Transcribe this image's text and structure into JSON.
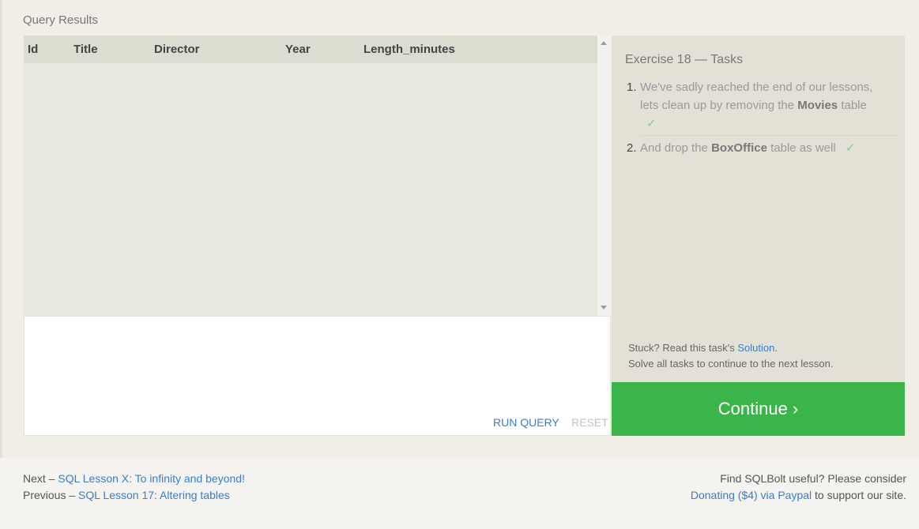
{
  "query_results": {
    "label": "Query Results",
    "columns": [
      "Id",
      "Title",
      "Director",
      "Year",
      "Length_minutes"
    ]
  },
  "editor": {
    "run_label": "RUN QUERY",
    "reset_label": "RESET"
  },
  "tasks": {
    "title": "Exercise 18 — Tasks",
    "items": [
      {
        "num": "1.",
        "pre": "We've sadly reached the end of our lessons, lets clean up by removing the",
        "bold": "Movies",
        "post": "table",
        "check": "✓"
      },
      {
        "num": "2.",
        "pre": "And drop the",
        "bold": "BoxOffice",
        "post": "table as well",
        "check": "✓"
      }
    ],
    "stuck_pre": "Stuck? Read this task's",
    "solution_label": "Solution",
    "stuck_post": ".",
    "solve_text": "Solve all tasks to continue to the next lesson."
  },
  "continue_label": "Continue ›",
  "footer": {
    "next_prefix": "Next –",
    "next_link": "SQL Lesson X: To infinity and beyond!",
    "prev_prefix": "Previous –",
    "prev_link": "SQL Lesson 17: Altering tables",
    "right_line1": "Find SQLBolt useful? Please consider",
    "donate_link": "Donating ($4) via Paypal",
    "right_suffix": "to support our site."
  },
  "colors": {
    "accent_green": "#3bb54a",
    "link_blue": "#3a7dc8",
    "check_green": "#8cc88c"
  },
  "icons": {
    "check": "check-icon",
    "scroll_up": "scroll-up-arrow-icon",
    "scroll_down": "scroll-down-arrow-icon"
  }
}
